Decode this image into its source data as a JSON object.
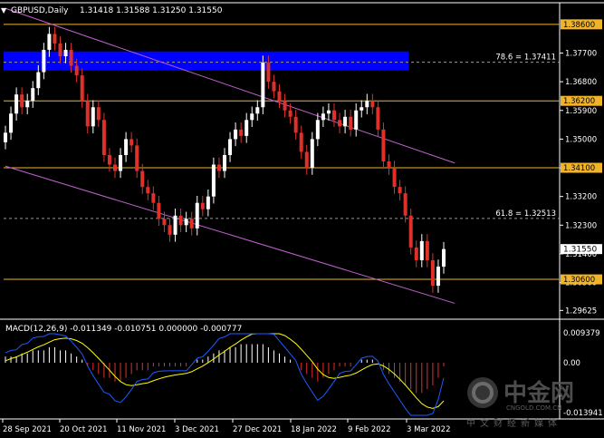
{
  "header": {
    "symbol": "GBPUSD,Daily",
    "ohlc": "1.31418 1.31588 1.31250 1.31550",
    "menu_icon": "triangle-down-icon"
  },
  "price_axis": {
    "ticks": [
      "1.37700",
      "1.36800",
      "1.35900",
      "1.35000",
      "1.34100",
      "1.33200",
      "1.32300",
      "1.31400",
      "1.30500",
      "1.29625"
    ]
  },
  "levels": [
    {
      "id": "r1",
      "price": 1.386,
      "label": "1.38600",
      "color": "#f0b32a"
    },
    {
      "id": "r2",
      "price": 1.362,
      "label": "1.36200",
      "color": "#f0b32a"
    },
    {
      "id": "r3",
      "price": 1.341,
      "label": "1.34100",
      "color": "#f0b32a"
    },
    {
      "id": "r4",
      "price": 1.306,
      "label": "1.30600",
      "color": "#f0b32a"
    }
  ],
  "current_price": {
    "label": "1.31550",
    "price": 1.3155
  },
  "fib_lines": [
    {
      "label": "78.6 = 1.37411",
      "price": 1.37411
    },
    {
      "label": "61.8 = 1.32513",
      "price": 1.32513
    }
  ],
  "zone": {
    "from": 1.3715,
    "to": 1.3775,
    "color": "#0000ff"
  },
  "channel": {
    "color": "#c060d0",
    "upper": {
      "from_bar": 0,
      "from_price": 1.391,
      "to_bar": 82,
      "to_price": 1.3425
    },
    "lower": {
      "from_bar": 0,
      "from_price": 1.3415,
      "to_bar": 82,
      "to_price": 1.2985
    }
  },
  "macd": {
    "label": "MACD(12,26,9) -0.011349 -0.010751 0.000000 -0.000777",
    "ticks": [
      "0.009379",
      "0.00",
      "-0.013941"
    ],
    "signal_color": "#ffff00",
    "main_color": "#1e5cff",
    "hist_pos_color": "#ffffff",
    "hist_neg_color": "#e0302a"
  },
  "date_axis": {
    "labels": [
      "28 Sep 2021",
      "20 Oct 2021",
      "11 Nov 2021",
      "3 Dec 2021",
      "27 Dec 2021",
      "18 Jan 2022",
      "9 Feb 2022",
      "3 Mar 2022"
    ]
  },
  "watermark": {
    "logo": "中金网",
    "site": "CNGOLD.COM.CN",
    "slogan": "中文财经新媒体"
  },
  "chart_data": {
    "type": "candlestick",
    "title": "GBPUSD,Daily",
    "ylim": [
      1.2935,
      1.3925
    ],
    "series": [
      {
        "name": "GBPUSD",
        "close": [
          1.352,
          1.358,
          1.364,
          1.36,
          1.362,
          1.366,
          1.371,
          1.378,
          1.383,
          1.38,
          1.376,
          1.378,
          1.373,
          1.37,
          1.362,
          1.354,
          1.36,
          1.356,
          1.345,
          1.342,
          1.34,
          1.345,
          1.35,
          1.348,
          1.34,
          1.335,
          1.333,
          1.33,
          1.325,
          1.323,
          1.32,
          1.326,
          1.323,
          1.325,
          1.322,
          1.33,
          1.328,
          1.332,
          1.342,
          1.34,
          1.345,
          1.35,
          1.353,
          1.351,
          1.356,
          1.358,
          1.36,
          1.374,
          1.368,
          1.365,
          1.362,
          1.359,
          1.357,
          1.352,
          1.346,
          1.341,
          1.35,
          1.356,
          1.358,
          1.359,
          1.356,
          1.354,
          1.357,
          1.353,
          1.359,
          1.36,
          1.362,
          1.36,
          1.353,
          1.343,
          1.341,
          1.335,
          1.333,
          1.326,
          1.316,
          1.312,
          1.318,
          1.312,
          1.304,
          1.31,
          1.3155
        ]
      }
    ],
    "macd_values": {
      "hist": [
        0.002,
        0.002,
        0.002,
        0.003,
        0.003,
        0.004,
        0.004,
        0.004,
        0.005,
        0.005,
        0.004,
        0.004,
        0.003,
        0.002,
        0.001,
        -0.001,
        -0.002,
        -0.003,
        -0.004,
        -0.004,
        -0.005,
        -0.005,
        -0.004,
        -0.003,
        -0.002,
        -0.002,
        -0.002,
        -0.001,
        -0.001,
        -0.001,
        -0.001,
        -0.001,
        -0.001,
        -0.001,
        0.0,
        0.001,
        0.001,
        0.002,
        0.003,
        0.004,
        0.004,
        0.005,
        0.005,
        0.006,
        0.006,
        0.006,
        0.006,
        0.006,
        0.005,
        0.004,
        0.003,
        0.002,
        0.001,
        0.0,
        -0.002,
        -0.003,
        -0.004,
        -0.005,
        -0.004,
        -0.003,
        -0.002,
        -0.001,
        -0.001,
        -0.001,
        0.0,
        0.001,
        0.001,
        0.001,
        0.0,
        -0.002,
        -0.003,
        -0.004,
        -0.005,
        -0.006,
        -0.007,
        -0.008,
        -0.008,
        -0.007,
        -0.006,
        -0.004,
        -0.001
      ]
    }
  }
}
